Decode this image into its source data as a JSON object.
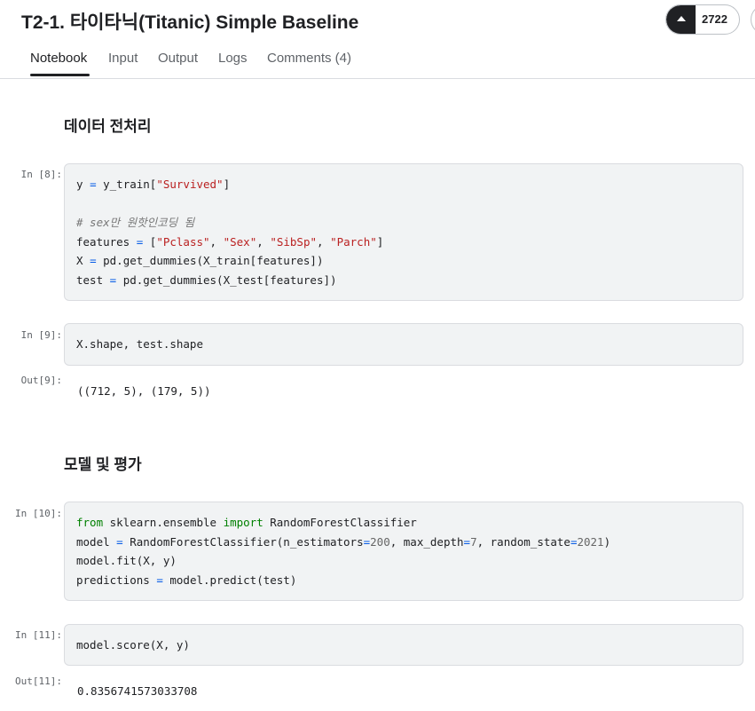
{
  "header": {
    "title": "T2-1. 타이타닉(Titanic) Simple Baseline",
    "vote_count": "2722"
  },
  "tabs": [
    "Notebook",
    "Input",
    "Output",
    "Logs",
    "Comments (4)"
  ],
  "active_tab": "Notebook",
  "sections": [
    {
      "heading": "데이터 전처리"
    },
    {
      "heading": "모델 및 평가"
    }
  ],
  "cells": [
    {
      "prompt": "In [8]:",
      "lines": [
        "y = y_train[\"Survived\"]",
        "",
        "# sex만 원핫인코딩 됨",
        "features = [\"Pclass\", \"Sex\", \"SibSp\", \"Parch\"]",
        "X = pd.get_dummies(X_train[features])",
        "test = pd.get_dummies(X_test[features])"
      ]
    },
    {
      "prompt": "In [9]:",
      "lines": [
        "X.shape, test.shape"
      ],
      "out_prompt": "Out[9]:",
      "output": "((712, 5), (179, 5))"
    },
    {
      "prompt": "In [10]:",
      "lines": [
        "from sklearn.ensemble import RandomForestClassifier",
        "model = RandomForestClassifier(n_estimators=200, max_depth=7, random_state=2021)",
        "model.fit(X, y)",
        "predictions = model.predict(test)"
      ]
    },
    {
      "prompt": "In [11]:",
      "lines": [
        "model.score(X, y)"
      ],
      "out_prompt": "Out[11]:",
      "output": "0.8356741573033708"
    }
  ],
  "colors": {
    "keyword": "#008000",
    "string": "#ba2121",
    "operator": "#055be6",
    "number": "#666666",
    "comment": "#777777"
  }
}
